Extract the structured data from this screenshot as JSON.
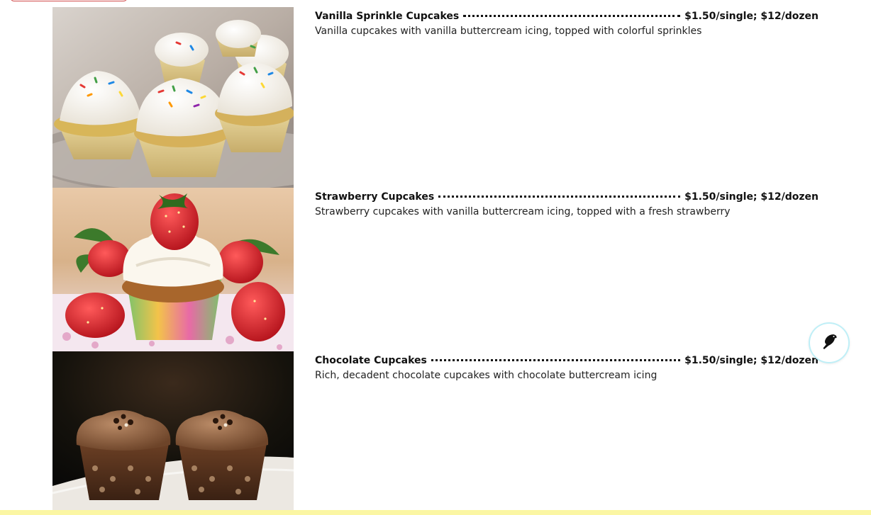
{
  "menu": {
    "items": [
      {
        "name": "Vanilla Sprinkle Cupcakes",
        "price": "$1.50/single; $12/dozen",
        "description": "Vanilla cupcakes with vanilla buttercream icing, topped with colorful sprinkles"
      },
      {
        "name": "Strawberry Cupcakes",
        "price": "$1.50/single; $12/dozen",
        "description": "Strawberry cupcakes with vanilla buttercream icing, topped with a fresh strawberry"
      },
      {
        "name": "Chocolate Cupcakes",
        "price": "$1.50/single; $12/dozen",
        "description": "Rich, decadent chocolate cupcakes with chocolate buttercream icing"
      }
    ]
  },
  "icons": {
    "float_button": "bird-icon"
  },
  "colors": {
    "bottom_bar": "#fbf6a3",
    "float_ring": "#bfeff7"
  }
}
